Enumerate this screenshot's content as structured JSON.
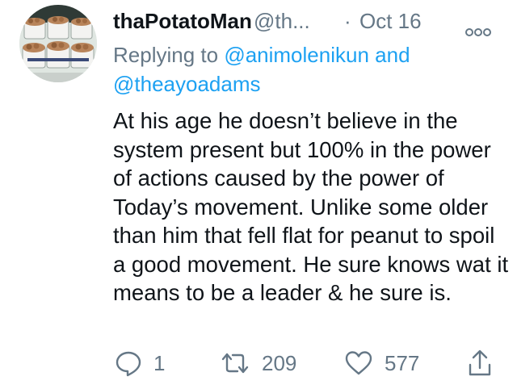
{
  "tweet": {
    "display_name": "thaPotatoMan",
    "handle": "@th...",
    "separator": "·",
    "date": "Oct 16",
    "reply_prefix": "Replying to",
    "reply_mention_1": "@animolenikun",
    "reply_conjunction": "and",
    "reply_mention_2": "@theayoadams",
    "body": "At his age he doesn’t believe in the system present but 100% in the power of actions caused by the power of Today’s movement. Unlike some older than him that fell flat for peanut to spoil a good movement. He sure knows wat it means to be a leader & he sure is."
  },
  "actions": {
    "reply_count": "1",
    "retweet_count": "209",
    "like_count": "577"
  },
  "icons": {
    "reply": "comment-icon",
    "retweet": "retweet-icon",
    "like": "heart-icon",
    "share": "share-icon",
    "more": "more-options-icon"
  },
  "colors": {
    "text": "#0f1419",
    "secondary": "#657786",
    "link": "#1da1f2"
  }
}
